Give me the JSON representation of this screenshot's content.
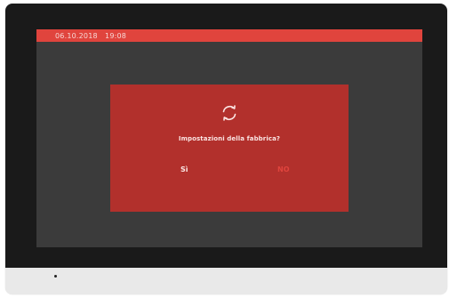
{
  "status_bar": {
    "date": "06.10.2018",
    "time": "19:08"
  },
  "dialog": {
    "icon": "refresh-icon",
    "message": "Impostazioni della fabbrica?",
    "yes_label": "Sì",
    "no_label": "NO"
  },
  "colors": {
    "status_bar": "#e0443d",
    "dialog_background": "#b2302c",
    "screen_background": "#3b3b3b",
    "bezel": "#1a1a1a",
    "no_button_text": "#e0443d"
  }
}
